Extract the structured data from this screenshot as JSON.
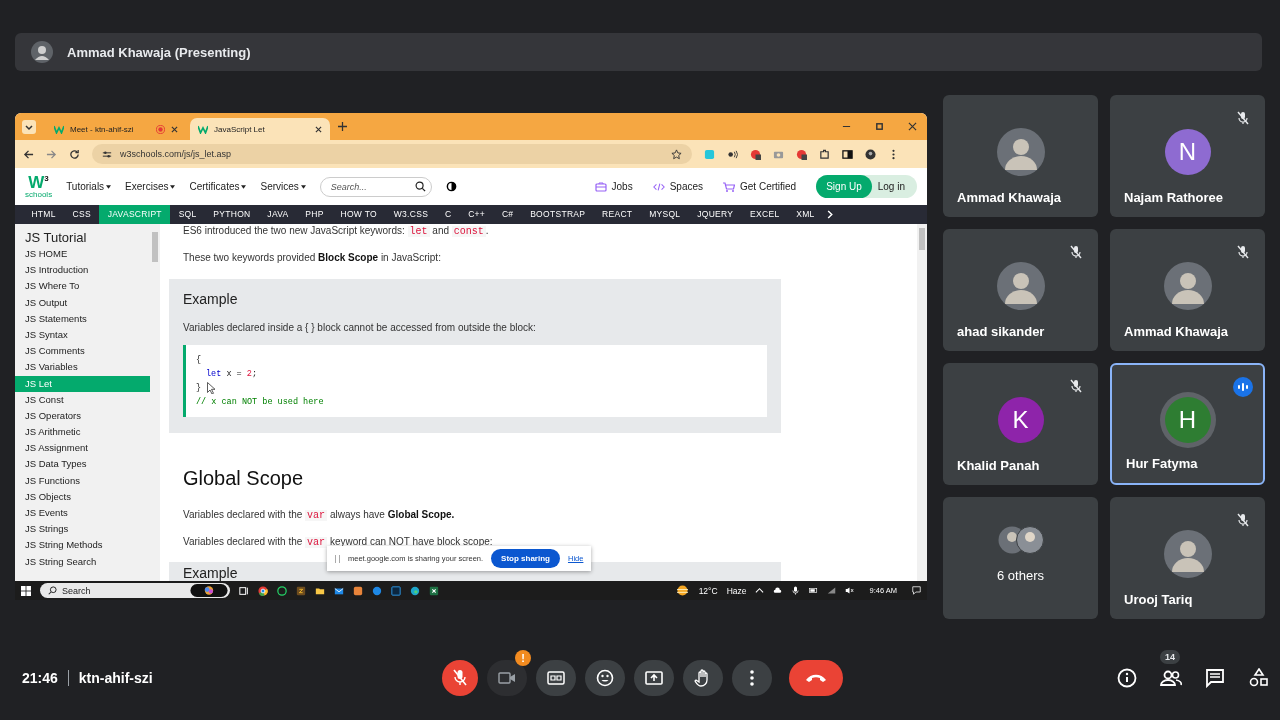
{
  "presenter_bar": {
    "label": "Ammad Khawaja (Presenting)"
  },
  "browser": {
    "tabs": [
      {
        "title": "Meet - ktn-ahif-szi",
        "selected": false,
        "recording": true
      },
      {
        "title": "JavaScript Let",
        "selected": true,
        "recording": false
      }
    ],
    "address": "w3schools.com/js/js_let.asp"
  },
  "site": {
    "logo": {
      "mark": "W",
      "sup": "3",
      "word": "schools"
    },
    "menus": [
      "Tutorials",
      "Exercises",
      "Certificates",
      "Services"
    ],
    "search": {
      "placeholder": "Search..."
    },
    "links": [
      {
        "kind": "jobs",
        "label": "Jobs"
      },
      {
        "kind": "spaces",
        "label": "Spaces"
      },
      {
        "kind": "cart",
        "label": "Get Certified"
      }
    ],
    "sign_up": "Sign Up",
    "log_in": "Log in",
    "topics": [
      {
        "label": "HTML",
        "selected": false
      },
      {
        "label": "CSS",
        "selected": false
      },
      {
        "label": "JAVASCRIPT",
        "selected": true
      },
      {
        "label": "SQL",
        "selected": false
      },
      {
        "label": "PYTHON",
        "selected": false
      },
      {
        "label": "JAVA",
        "selected": false
      },
      {
        "label": "PHP",
        "selected": false
      },
      {
        "label": "HOW TO",
        "selected": false
      },
      {
        "label": "W3.CSS",
        "selected": false
      },
      {
        "label": "C",
        "selected": false
      },
      {
        "label": "C++",
        "selected": false
      },
      {
        "label": "C#",
        "selected": false
      },
      {
        "label": "BOOTSTRAP",
        "selected": false
      },
      {
        "label": "REACT",
        "selected": false
      },
      {
        "label": "MYSQL",
        "selected": false
      },
      {
        "label": "JQUERY",
        "selected": false
      },
      {
        "label": "EXCEL",
        "selected": false
      },
      {
        "label": "XML",
        "selected": false
      }
    ],
    "sidebar": {
      "title": "JS Tutorial",
      "items": [
        {
          "label": "JS HOME",
          "selected": false
        },
        {
          "label": "JS Introduction",
          "selected": false
        },
        {
          "label": "JS Where To",
          "selected": false
        },
        {
          "label": "JS Output",
          "selected": false
        },
        {
          "label": "JS Statements",
          "selected": false
        },
        {
          "label": "JS Syntax",
          "selected": false
        },
        {
          "label": "JS Comments",
          "selected": false
        },
        {
          "label": "JS Variables",
          "selected": false
        },
        {
          "label": "JS Let",
          "selected": true
        },
        {
          "label": "JS Const",
          "selected": false
        },
        {
          "label": "JS Operators",
          "selected": false
        },
        {
          "label": "JS Arithmetic",
          "selected": false
        },
        {
          "label": "JS Assignment",
          "selected": false
        },
        {
          "label": "JS Data Types",
          "selected": false
        },
        {
          "label": "JS Functions",
          "selected": false
        },
        {
          "label": "JS Objects",
          "selected": false
        },
        {
          "label": "JS Events",
          "selected": false
        },
        {
          "label": "JS Strings",
          "selected": false
        },
        {
          "label": "JS String Methods",
          "selected": false
        },
        {
          "label": "JS String Search",
          "selected": false
        }
      ]
    },
    "content": [
      {
        "kind": "paragraph",
        "parts": [
          {
            "kind": "text",
            "text": "ES6 introduced the two new JavaScript keywords: "
          },
          {
            "kind": "code",
            "text": "let"
          },
          {
            "kind": "text",
            "text": " and "
          },
          {
            "kind": "code",
            "text": "const"
          },
          {
            "kind": "text",
            "text": "."
          }
        ]
      },
      {
        "kind": "paragraph",
        "parts": [
          {
            "kind": "text",
            "text": "These two keywords provided "
          },
          {
            "kind": "bold",
            "text": "Block Scope"
          },
          {
            "kind": "text",
            "text": " in JavaScript:"
          }
        ]
      },
      {
        "kind": "example",
        "heading": "Example",
        "text": "Variables declared inside a { } block cannot be accessed from outside the block:",
        "code": [
          {
            "indent": false,
            "tokens": [
              {
                "kind": "plain",
                "text": "{"
              }
            ]
          },
          {
            "indent": true,
            "tokens": [
              {
                "kind": "keyword",
                "text": "let"
              },
              {
                "kind": "plain",
                "text": " x = "
              },
              {
                "kind": "number",
                "text": "2"
              },
              {
                "kind": "plain",
                "text": ";"
              }
            ]
          },
          {
            "indent": false,
            "tokens": [
              {
                "kind": "plain",
                "text": "}"
              }
            ]
          },
          {
            "indent": false,
            "tokens": [
              {
                "kind": "comment",
                "text": "// x can NOT be used here"
              }
            ]
          }
        ]
      },
      {
        "kind": "heading",
        "text": "Global Scope"
      },
      {
        "kind": "paragraph",
        "parts": [
          {
            "kind": "text",
            "text": "Variables declared with the "
          },
          {
            "kind": "code",
            "text": "var"
          },
          {
            "kind": "text",
            "text": " always have "
          },
          {
            "kind": "bold",
            "text": "Global Scope."
          }
        ]
      },
      {
        "kind": "paragraph",
        "parts": [
          {
            "kind": "text",
            "text": "Variables declared with the "
          },
          {
            "kind": "code",
            "text": "var"
          },
          {
            "kind": "text",
            "text": " keyword can NOT have block scope:"
          }
        ]
      },
      {
        "kind": "example",
        "heading": "Example"
      }
    ]
  },
  "share_banner": {
    "text": "meet.google.com is sharing your screen.",
    "stop": "Stop sharing",
    "hide": "Hide"
  },
  "taskbar": {
    "search": {
      "placeholder": "Search"
    },
    "temperature": "12°C",
    "weather": "Haze",
    "time": "9:46 AM"
  },
  "tiles": [
    {
      "name": "Ammad Khawaja",
      "kind": "photo",
      "muted": false,
      "speaking": false
    },
    {
      "name": "Najam Rathoree",
      "kind": "letter",
      "letter": "N",
      "color": "#8e6bd1",
      "muted": true,
      "speaking": false
    },
    {
      "name": "ahad sikander",
      "kind": "photo",
      "muted": true,
      "speaking": false
    },
    {
      "name": "Ammad Khawaja",
      "kind": "photo",
      "muted": true,
      "speaking": false
    },
    {
      "name": "Khalid Panah",
      "kind": "letter",
      "letter": "K",
      "color": "#8e24aa",
      "muted": true,
      "speaking": false
    },
    {
      "name": "Hur Fatyma",
      "kind": "letter",
      "letter": "H",
      "color": "#2e7d32",
      "muted": false,
      "speaking": true
    },
    {
      "name": "6 others",
      "kind": "group",
      "muted": false,
      "speaking": false
    },
    {
      "name": "Urooj Tariq",
      "kind": "photo",
      "muted": true,
      "speaking": false
    }
  ],
  "meeting": {
    "time": "21:46",
    "code": "ktn-ahif-szi",
    "controls": [
      {
        "kind": "mic",
        "on": false
      },
      {
        "kind": "camera",
        "on": false,
        "alert": "!"
      },
      {
        "kind": "captions"
      },
      {
        "kind": "emoji"
      },
      {
        "kind": "present"
      },
      {
        "kind": "hand"
      },
      {
        "kind": "more"
      },
      {
        "kind": "leave"
      }
    ],
    "participants": "14"
  }
}
